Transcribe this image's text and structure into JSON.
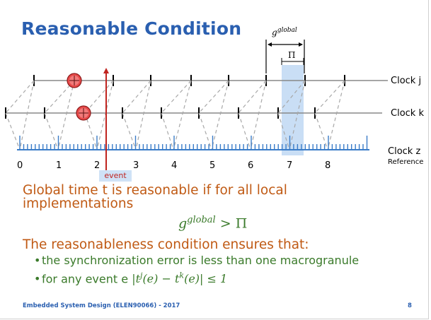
{
  "slide": {
    "title": "Reasonable Condition",
    "g_global_label": "g",
    "g_global_sup": "global",
    "pi_label": "Π",
    "event_label": "event",
    "clock_labels": {
      "clock_j": "Clock j",
      "clock_k": "Clock k",
      "clock_z": "Clock z",
      "reference": "Reference"
    },
    "macrotick_numbers": [
      "0",
      "1",
      "2",
      "3",
      "4",
      "5",
      "6",
      "7",
      "8"
    ],
    "body_text": "Global time t is reasonable if for all local implementations",
    "formula_g": "g",
    "formula_sup": "global",
    "formula_rest": " > Π",
    "sub_head": "The reasonableness condition ensures that:",
    "bullets": [
      "the synchronization error is less than one macrogranule",
      "for any event e"
    ],
    "bullet_math": "|t",
    "bullet_math_j": "j",
    "bullet_math_mid": "(e) − t",
    "bullet_math_k": "k",
    "bullet_math_end": "(e)| ≤ 1",
    "footer_left": "Embedded System Design (ELEN90066) - 2017",
    "footer_right": "8",
    "colors": {
      "title": "#2a5fb0",
      "body": "#c05a14",
      "green": "#3a7a2a",
      "event_line": "#c0241f",
      "tick_blue": "#3a7cc8"
    }
  }
}
